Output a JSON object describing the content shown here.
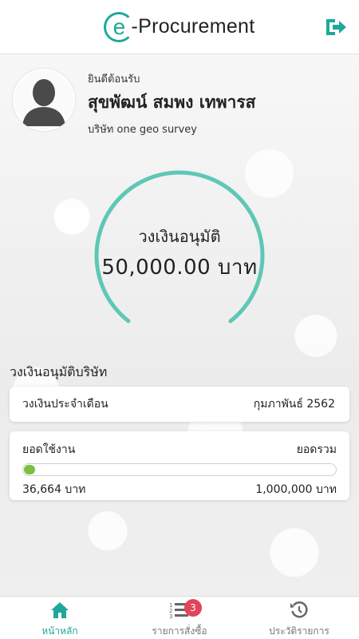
{
  "header": {
    "logo_e": "e",
    "logo_text": "-Procurement",
    "logout_icon": "logout-icon",
    "brand_color": "#1fa89a"
  },
  "profile": {
    "welcome": "ยินดีต้อนรับ",
    "name": "สุขพัฒน์ สมพง เทพารส",
    "company": "บริษัท one geo survey"
  },
  "gauge": {
    "label": "วงเงินอนุมัติ",
    "amount": "50,000.00 บาท",
    "color": "#5ec7b6"
  },
  "company_limit": {
    "title": "วงเงินอนุมัติบริษัท",
    "monthly_label": "วงเงินประจำเดือน",
    "month_value": "กุมภาพันธ์ 2562",
    "used_label": "ยอดใช้งาน",
    "total_label": "ยอดรวม",
    "used_value": "36,664 บาท",
    "total_value": "1,000,000 บาท",
    "used_fraction": 0.037,
    "progress_color": "#7ac043"
  },
  "bottom_nav": {
    "items": [
      {
        "label": "หน้าหลัก",
        "icon": "home-icon",
        "active": true
      },
      {
        "label": "รายการสั่งซื้อ",
        "icon": "numbered-list-icon",
        "badge": "3"
      },
      {
        "label": "ประวัติรายการ",
        "icon": "history-icon"
      }
    ],
    "badge_color": "#e0455a"
  }
}
